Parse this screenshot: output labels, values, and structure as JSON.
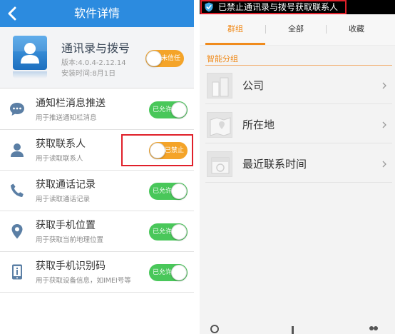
{
  "left_screen": {
    "header": {
      "title": "软件详情"
    },
    "app": {
      "name": "通讯录与拨号",
      "version": "版本:4.0.4-2.12.14",
      "install_time": "安装时间:8月1日",
      "trust_toggle": {
        "label": "未信任",
        "state": "off"
      }
    },
    "permissions": [
      {
        "title": "通知栏消息推送",
        "desc": "用于推送通知栏消息",
        "toggle_label": "已允许",
        "state": "on",
        "icon": "chat-bubble-icon"
      },
      {
        "title": "获取联系人",
        "desc": "用于读取联系人",
        "toggle_label": "已禁止",
        "state": "off",
        "icon": "person-icon"
      },
      {
        "title": "获取通话记录",
        "desc": "用于读取通话记录",
        "toggle_label": "已允许",
        "state": "on",
        "icon": "phone-icon"
      },
      {
        "title": "获取手机位置",
        "desc": "用于获取当前地理位置",
        "toggle_label": "已允许",
        "state": "on",
        "icon": "location-pin-icon"
      },
      {
        "title": "获取手机识别码",
        "desc": "用于获取设备信息，如IMEI号等",
        "toggle_label": "已允许",
        "state": "on",
        "icon": "phone-id-icon"
      }
    ]
  },
  "right_screen": {
    "status_notification": "已禁止通讯录与拨号获取联系人",
    "tabs": [
      {
        "label": "群组",
        "active": true
      },
      {
        "label": "全部",
        "active": false
      },
      {
        "label": "收藏",
        "active": false
      }
    ],
    "section_title": "智能分组",
    "groups": [
      {
        "label": "公司",
        "icon": "building-icon"
      },
      {
        "label": "所在地",
        "icon": "map-icon"
      },
      {
        "label": "最近联系时间",
        "icon": "calendar-icon"
      }
    ]
  },
  "colors": {
    "header_blue": "#2c8bdf",
    "toggle_on": "#49c75a",
    "toggle_off": "#f4a429",
    "accent_orange": "#f08b1c",
    "highlight_red": "#e0202a"
  }
}
